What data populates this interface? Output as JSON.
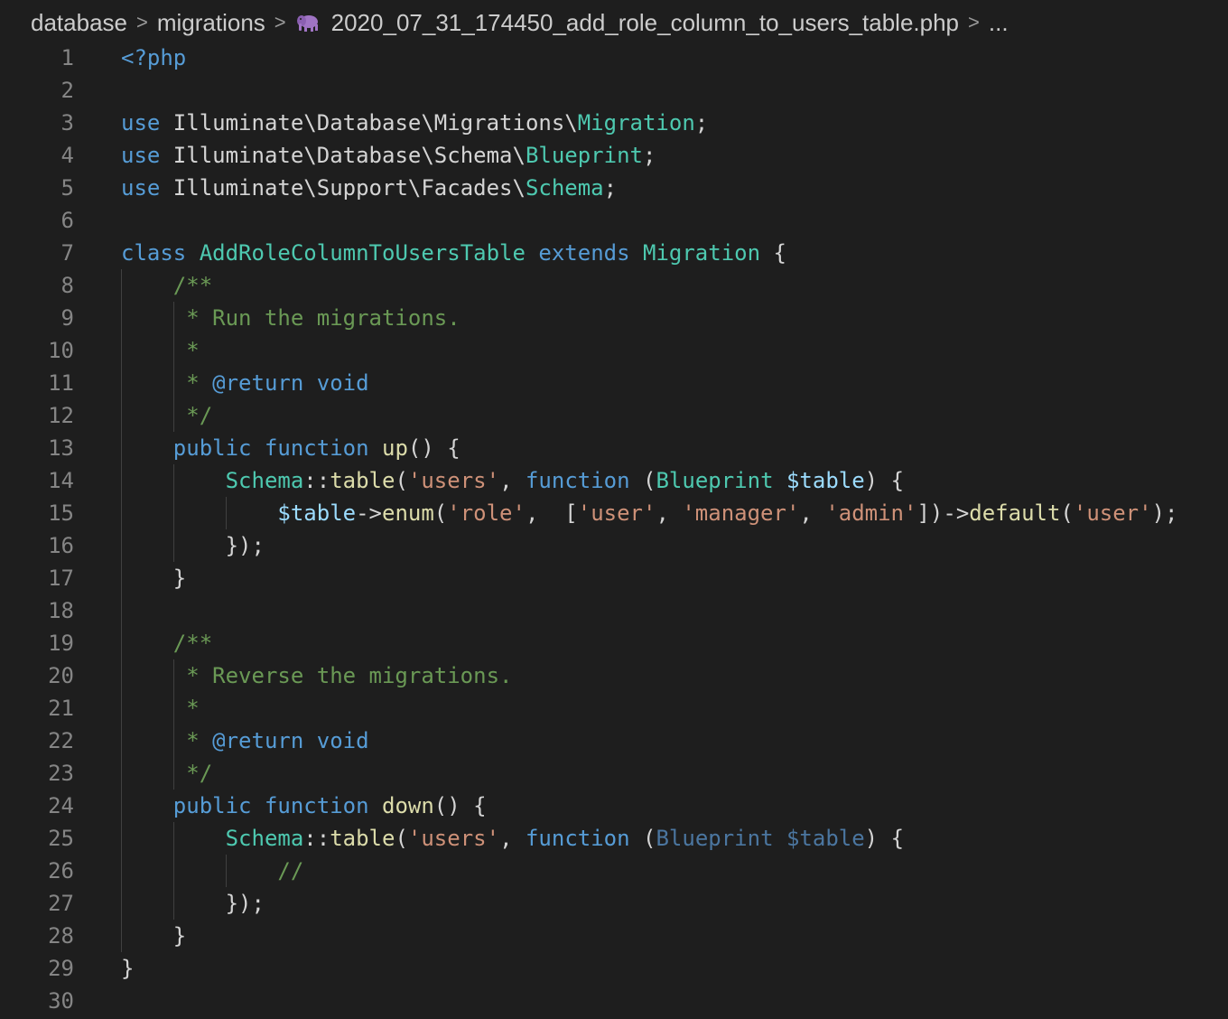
{
  "breadcrumb": {
    "items": [
      "database",
      "migrations"
    ],
    "file": "2020_07_31_174450_add_role_column_to_users_table.php",
    "more": "...",
    "separator": ">"
  },
  "file_icon": "php-elephant-icon",
  "colors": {
    "background": "#1e1e1e",
    "keyword": "#569cd6",
    "class": "#4ec9b0",
    "function": "#dcdcaa",
    "string": "#ce9178",
    "variable": "#9cdcfe",
    "comment": "#6a9955",
    "line_number": "#858585"
  },
  "line_numbers": [
    "1",
    "2",
    "3",
    "4",
    "5",
    "6",
    "7",
    "8",
    "9",
    "10",
    "11",
    "12",
    "13",
    "14",
    "15",
    "16",
    "17",
    "18",
    "19",
    "20",
    "21",
    "22",
    "23",
    "24",
    "25",
    "26",
    "27",
    "28",
    "29",
    "30"
  ],
  "lines": [
    [
      [
        "k",
        "<?php"
      ]
    ],
    [],
    [
      [
        "k",
        "use"
      ],
      [
        "t",
        " Illuminate\\Database\\Migrations\\"
      ],
      [
        "c",
        "Migration"
      ],
      [
        "t",
        ";"
      ]
    ],
    [
      [
        "k",
        "use"
      ],
      [
        "t",
        " Illuminate\\Database\\Schema\\"
      ],
      [
        "c",
        "Blueprint"
      ],
      [
        "t",
        ";"
      ]
    ],
    [
      [
        "k",
        "use"
      ],
      [
        "t",
        " Illuminate\\Support\\Facades\\"
      ],
      [
        "c",
        "Schema"
      ],
      [
        "t",
        ";"
      ]
    ],
    [],
    [
      [
        "k",
        "class"
      ],
      [
        "t",
        " "
      ],
      [
        "c",
        "AddRoleColumnToUsersTable"
      ],
      [
        "t",
        " "
      ],
      [
        "k",
        "extends"
      ],
      [
        "t",
        " "
      ],
      [
        "c",
        "Migration"
      ],
      [
        "t",
        " {"
      ]
    ],
    [
      [
        "t",
        "    "
      ],
      [
        "cm",
        "/**"
      ]
    ],
    [
      [
        "t",
        "    "
      ],
      [
        "cm",
        " * Run the migrations."
      ]
    ],
    [
      [
        "t",
        "    "
      ],
      [
        "cm",
        " *"
      ]
    ],
    [
      [
        "t",
        "    "
      ],
      [
        "cm",
        " * "
      ],
      [
        "ck",
        "@return"
      ],
      [
        "cm",
        " "
      ],
      [
        "ck",
        "void"
      ]
    ],
    [
      [
        "t",
        "    "
      ],
      [
        "cm",
        " */"
      ]
    ],
    [
      [
        "t",
        "    "
      ],
      [
        "k",
        "public"
      ],
      [
        "t",
        " "
      ],
      [
        "k",
        "function"
      ],
      [
        "t",
        " "
      ],
      [
        "f",
        "up"
      ],
      [
        "t",
        "() {"
      ]
    ],
    [
      [
        "t",
        "        "
      ],
      [
        "c",
        "Schema"
      ],
      [
        "t",
        "::"
      ],
      [
        "f",
        "table"
      ],
      [
        "t",
        "("
      ],
      [
        "s",
        "'users'"
      ],
      [
        "t",
        ", "
      ],
      [
        "k",
        "function"
      ],
      [
        "t",
        " ("
      ],
      [
        "c",
        "Blueprint"
      ],
      [
        "t",
        " "
      ],
      [
        "v",
        "$table"
      ],
      [
        "t",
        ") {"
      ]
    ],
    [
      [
        "t",
        "            "
      ],
      [
        "v",
        "$table"
      ],
      [
        "t",
        "->"
      ],
      [
        "f",
        "enum"
      ],
      [
        "t",
        "("
      ],
      [
        "s",
        "'role'"
      ],
      [
        "t",
        ",  ["
      ],
      [
        "s",
        "'user'"
      ],
      [
        "t",
        ", "
      ],
      [
        "s",
        "'manager'"
      ],
      [
        "t",
        ", "
      ],
      [
        "s",
        "'admin'"
      ],
      [
        "t",
        "])->"
      ],
      [
        "f",
        "default"
      ],
      [
        "t",
        "("
      ],
      [
        "s",
        "'user'"
      ],
      [
        "t",
        ");"
      ]
    ],
    [
      [
        "t",
        "        });"
      ]
    ],
    [
      [
        "t",
        "    }"
      ]
    ],
    [],
    [
      [
        "t",
        "    "
      ],
      [
        "cm",
        "/**"
      ]
    ],
    [
      [
        "t",
        "    "
      ],
      [
        "cm",
        " * Reverse the migrations."
      ]
    ],
    [
      [
        "t",
        "    "
      ],
      [
        "cm",
        " *"
      ]
    ],
    [
      [
        "t",
        "    "
      ],
      [
        "cm",
        " * "
      ],
      [
        "ck",
        "@return"
      ],
      [
        "cm",
        " "
      ],
      [
        "ck",
        "void"
      ]
    ],
    [
      [
        "t",
        "    "
      ],
      [
        "cm",
        " */"
      ]
    ],
    [
      [
        "t",
        "    "
      ],
      [
        "k",
        "public"
      ],
      [
        "t",
        " "
      ],
      [
        "k",
        "function"
      ],
      [
        "t",
        " "
      ],
      [
        "f",
        "down"
      ],
      [
        "t",
        "() {"
      ]
    ],
    [
      [
        "t",
        "        "
      ],
      [
        "c",
        "Schema"
      ],
      [
        "t",
        "::"
      ],
      [
        "f",
        "table"
      ],
      [
        "t",
        "("
      ],
      [
        "s",
        "'users'"
      ],
      [
        "t",
        ", "
      ],
      [
        "k",
        "function"
      ],
      [
        "t",
        " ("
      ],
      [
        "dim",
        "Blueprint"
      ],
      [
        "t",
        " "
      ],
      [
        "dim",
        "$table"
      ],
      [
        "t",
        ") {"
      ]
    ],
    [
      [
        "t",
        "            "
      ],
      [
        "cm",
        "//"
      ]
    ],
    [
      [
        "t",
        "        });"
      ]
    ],
    [
      [
        "t",
        "    }"
      ]
    ],
    [
      [
        "t",
        "}"
      ]
    ],
    []
  ]
}
